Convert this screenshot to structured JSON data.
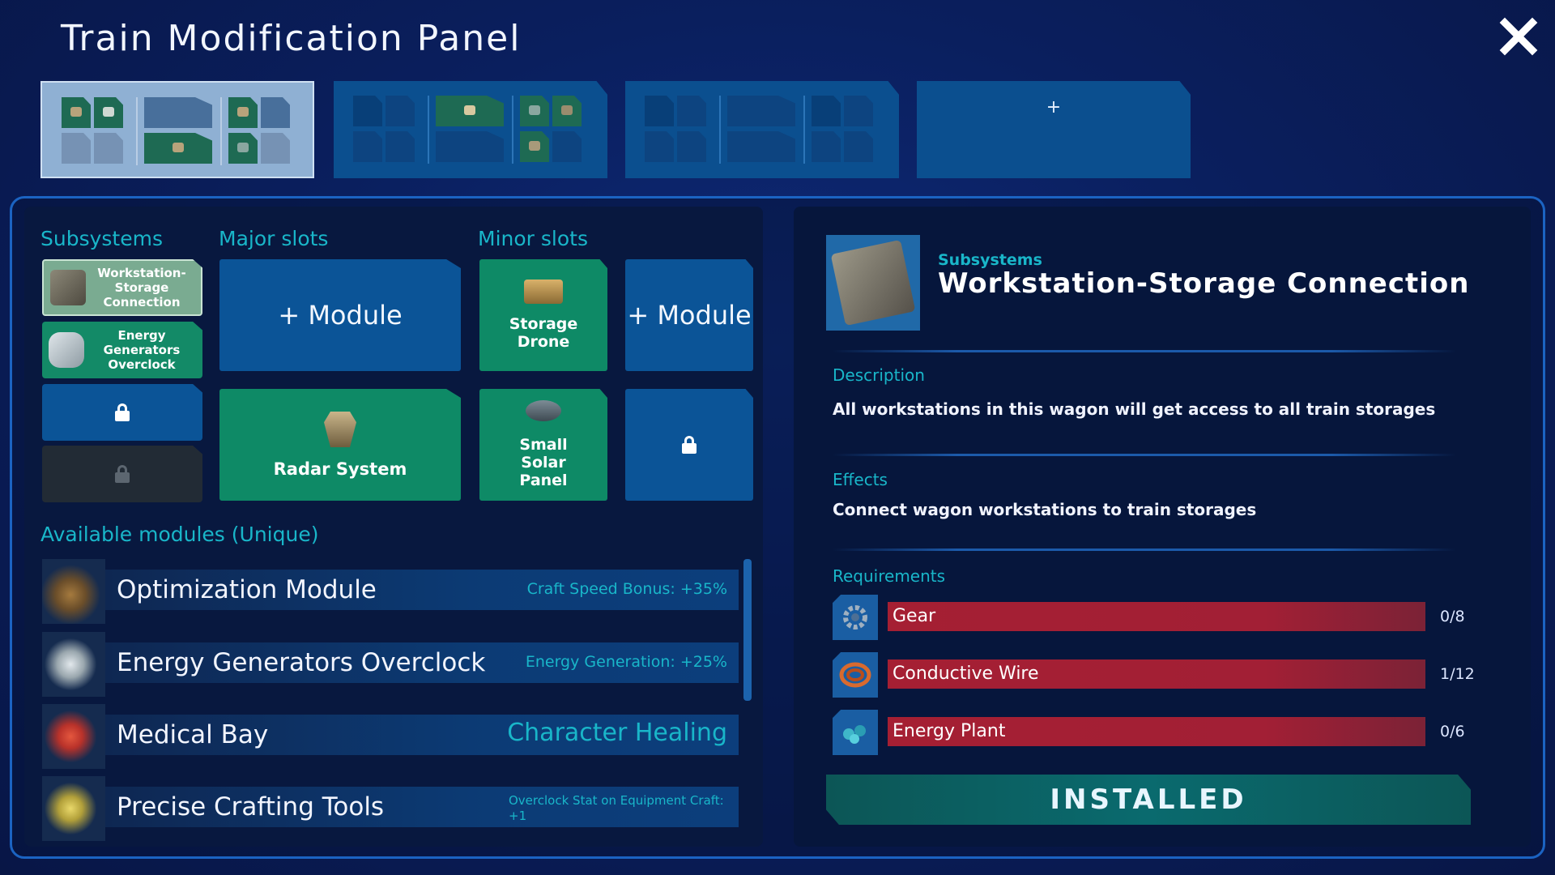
{
  "header": {
    "title": "Train Modification Panel"
  },
  "wagons": {
    "add_label": "+"
  },
  "labels": {
    "subsystems": "Subsystems",
    "major_slots": "Major slots",
    "minor_slots": "Minor slots",
    "available_modules": "Available modules (Unique)"
  },
  "subsystems": [
    {
      "label": "Workstation-Storage Connection",
      "state": "selected"
    },
    {
      "label": "Energy Generators Overclock",
      "state": "installed"
    },
    {
      "state": "locked"
    },
    {
      "state": "locked-disabled"
    }
  ],
  "major_slots": [
    {
      "label": "+ Module",
      "state": "empty"
    },
    {
      "label": "Radar System",
      "state": "filled"
    }
  ],
  "minor_slots": [
    {
      "label": "Storage Drone",
      "state": "filled"
    },
    {
      "label": "+ Module",
      "state": "empty"
    },
    {
      "label": "Small Solar Panel",
      "state": "filled"
    },
    {
      "state": "locked"
    }
  ],
  "modules": [
    {
      "name": "Optimization Module",
      "stat": "Craft Speed Bonus:  +35%"
    },
    {
      "name": "Energy Generators Overclock",
      "stat": "Energy Generation:  +25%"
    },
    {
      "name": "Medical Bay",
      "stat": "Character Healing"
    },
    {
      "name": "Precise Crafting Tools",
      "stat": "Overclock Stat on Equipment Craft: +1"
    }
  ],
  "detail": {
    "category": "Subsystems",
    "title": "Workstation-Storage Connection",
    "description_label": "Description",
    "description": "All workstations in this wagon will get access to all train storages",
    "effects_label": "Effects",
    "effects": "Connect wagon workstations to train storages",
    "requirements_label": "Requirements",
    "requirements": [
      {
        "name": "Gear",
        "count": "0/8"
      },
      {
        "name": "Conductive Wire",
        "count": "1/12"
      },
      {
        "name": "Energy Plant",
        "count": "0/6"
      }
    ],
    "button_label": "INSTALLED"
  },
  "colors": {
    "accent_cyan": "#19b6c9",
    "slot_blue": "#0b5497",
    "slot_green": "#0e8a66",
    "requirement_red": "#a51f33"
  }
}
